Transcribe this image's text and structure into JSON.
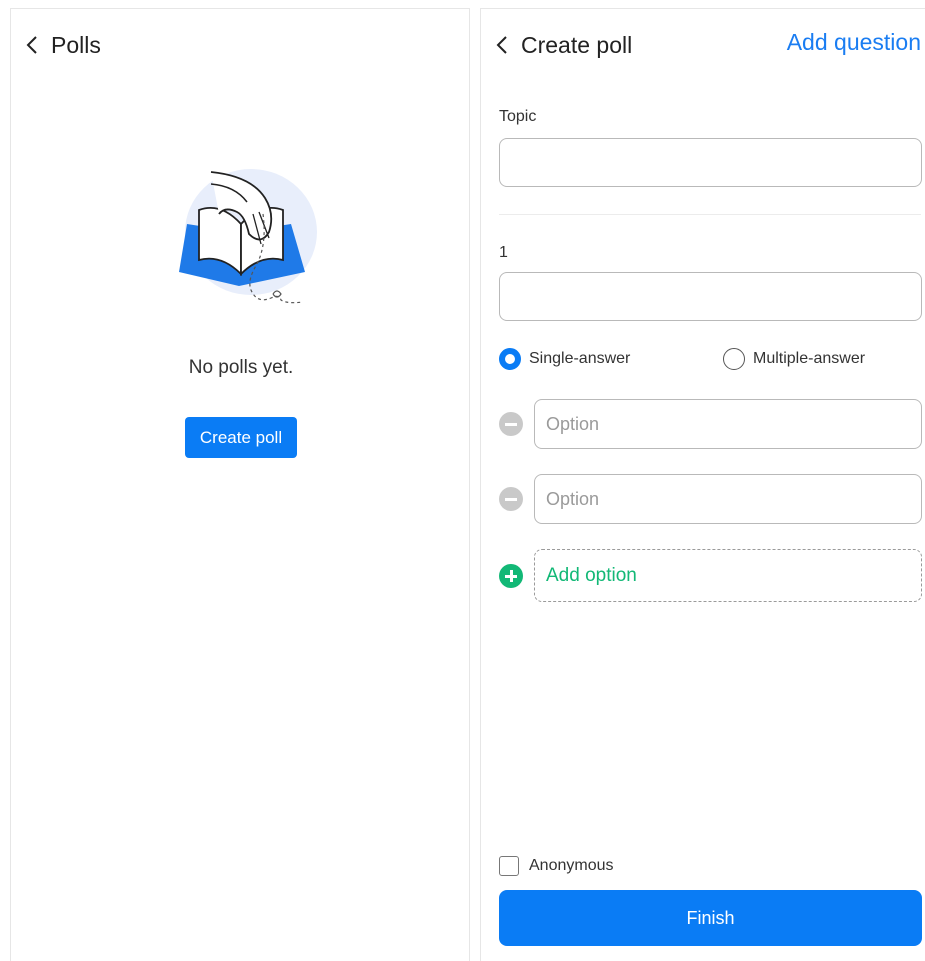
{
  "colors": {
    "primary": "#0a7cf5",
    "link": "#1a7df2",
    "success": "#12b876",
    "border": "#b9b9b9"
  },
  "polls_panel": {
    "back_icon": "chevron-left-icon",
    "title": "Polls",
    "illustration": "empty-book-hand-illustration",
    "empty_text": "No polls yet.",
    "create_button": "Create poll"
  },
  "create_panel": {
    "back_icon": "chevron-left-icon",
    "title": "Create poll",
    "add_question": "Add question",
    "topic_label": "Topic",
    "topic_value": "",
    "question_number": "1",
    "question_value": "",
    "answer_types": [
      {
        "label": "Single-answer",
        "selected": true
      },
      {
        "label": "Multiple-answer",
        "selected": false
      }
    ],
    "options": [
      {
        "placeholder": "Option",
        "remove_icon": "minus-circle-icon"
      },
      {
        "placeholder": "Option",
        "remove_icon": "minus-circle-icon"
      }
    ],
    "add_option": {
      "label": "Add option",
      "icon": "plus-circle-icon"
    },
    "anonymous": {
      "label": "Anonymous",
      "checked": false
    },
    "finish_button": "Finish"
  }
}
